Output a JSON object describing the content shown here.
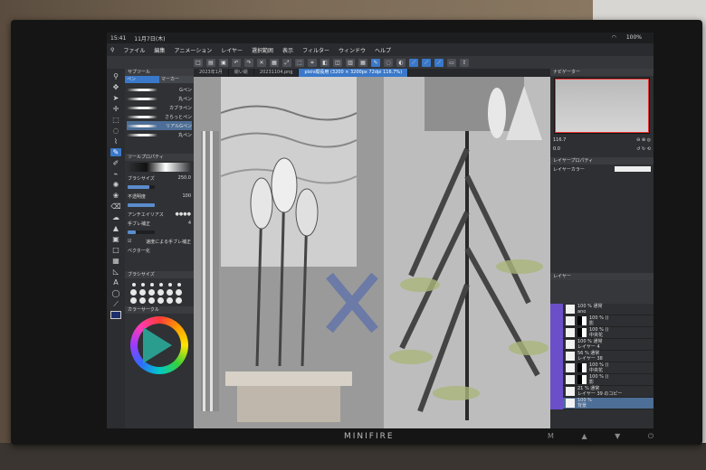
{
  "menubar": {
    "time": "15:41",
    "date": "11月7日(木)",
    "items": [
      "ファイル",
      "編集",
      "アニメーション",
      "レイヤー",
      "選択範囲",
      "表示",
      "フィルター",
      "ウィンドウ",
      "ヘルプ"
    ],
    "battery": "100%"
  },
  "left_panel": {
    "subtool_title": "サブツール",
    "tab_pen": "ペン",
    "tab_marker": "マーカー",
    "brushes": [
      "Gペン",
      "丸ペン",
      "カブラペン",
      "さらっとペン",
      "リアルGペン",
      "丸ペン"
    ],
    "tool_property_title": "ツールプロパティ",
    "brush_size_label": "ブラシサイズ",
    "brush_size_value": "250.0",
    "opacity_label": "不透明度",
    "opacity_value": "100",
    "antialias_label": "アンチエイリアス",
    "stabilize_label": "手ブレ補正",
    "stabilize_value": "4",
    "speed_stabilize_label": "速度による手ブレ補正",
    "pressure_label": "ベクター化",
    "brush_size_panel_title": "ブラシサイズ",
    "color_circle_title": "カラーサークル",
    "brush_size_fill": 0.8,
    "opacity_fill": 1.0,
    "stabilize_fill": 0.3
  },
  "doc_tabs": [
    "2023年1月",
    "絵い絵",
    "20231104.png",
    "pixiv縦長用 (3200 × 3200px 72dpi 116.7%)"
  ],
  "right_panel": {
    "navigator_title": "ナビゲーター",
    "zoom_value": "116.7",
    "angle_value": "0.0",
    "layer_property_title": "レイヤープロパティ",
    "layer_color_label": "レイヤーカラー",
    "layer_title": "レイヤー",
    "layers": [
      {
        "line1": "100 % 通常",
        "line2": "ano"
      },
      {
        "line1": "100 % ()",
        "line2": "影"
      },
      {
        "line1": "100 % ()",
        "line2": "中央花"
      },
      {
        "line1": "100 % 通常",
        "line2": "レイヤー 4"
      },
      {
        "line1": "56 % 通常",
        "line2": "レイヤー 38"
      },
      {
        "line1": "100 % ()",
        "line2": "中央花"
      },
      {
        "line1": "100 % ()",
        "line2": "影"
      },
      {
        "line1": "21 % 通常",
        "line2": "レイヤー 39 のコピー"
      },
      {
        "line1": "100 %",
        "line2": "背景"
      }
    ]
  },
  "monitor": {
    "brand": "MINIFIRE",
    "buttons": "M ▲ ▼ ⏻"
  }
}
